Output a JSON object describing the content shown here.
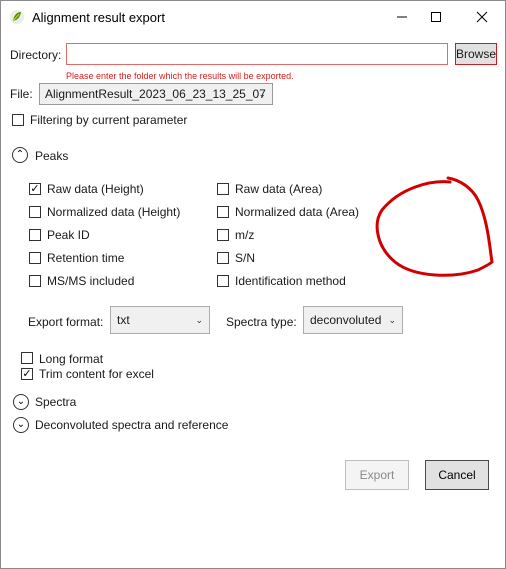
{
  "window": {
    "title": "Alignment result export",
    "minimize_icon": "minimize-icon",
    "maximize_icon": "maximize-icon",
    "close_icon": "close-icon",
    "app_icon": "app-leaf-icon"
  },
  "directory": {
    "label": "Directory:",
    "value": "",
    "browse_label": "Browse",
    "error": "Please enter the folder which the results will be exported."
  },
  "file": {
    "label": "File:",
    "selected": "AlignmentResult_2023_06_23_13_25_07"
  },
  "filtering": {
    "label": "Filtering by current parameter",
    "checked": false
  },
  "peaks": {
    "header": "Peaks",
    "expanded": true,
    "options": [
      {
        "label": "Raw data (Height)",
        "checked": true
      },
      {
        "label": "Raw data (Area)",
        "checked": false
      },
      {
        "label": "Normalized data (Height)",
        "checked": false
      },
      {
        "label": "Normalized data (Area)",
        "checked": false
      },
      {
        "label": "Peak ID",
        "checked": false
      },
      {
        "label": "m/z",
        "checked": false
      },
      {
        "label": "Retention time",
        "checked": false
      },
      {
        "label": "S/N",
        "checked": false
      },
      {
        "label": "MS/MS included",
        "checked": false
      },
      {
        "label": "Identification method",
        "checked": false
      }
    ],
    "export_format_label": "Export format:",
    "export_format_value": "txt",
    "spectra_type_label": "Spectra type:",
    "spectra_type_value": "deconvoluted",
    "long_format": {
      "label": "Long format",
      "checked": false
    },
    "trim_excel": {
      "label": "Trim content for excel",
      "checked": true
    }
  },
  "spectra": {
    "header": "Spectra",
    "expanded": false
  },
  "deconvoluted": {
    "header": "Deconvoluted spectra and reference",
    "expanded": false
  },
  "footer": {
    "export_label": "Export",
    "cancel_label": "Cancel"
  },
  "colors": {
    "error_red": "#d41e1e",
    "annotation_red": "#d10000"
  }
}
